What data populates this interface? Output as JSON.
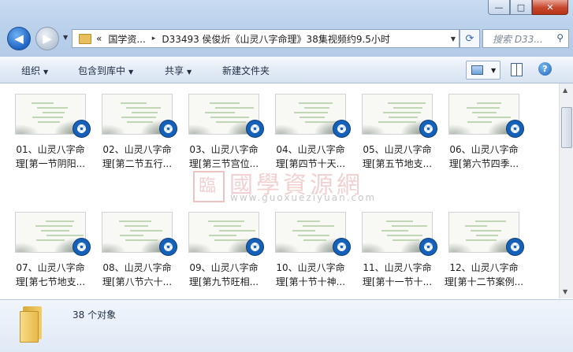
{
  "window": {
    "buttons": {
      "minimize": "—",
      "maximize": "□",
      "close": "✕"
    }
  },
  "nav": {
    "back": "back-icon",
    "forward": "forward-icon"
  },
  "address": {
    "chevron": "«",
    "segments": [
      "国学资...",
      "D33493 侯俊炘《山灵八字命理》38集视频约9.5小时"
    ],
    "separator": "▸"
  },
  "search": {
    "placeholder": "搜索 D33..."
  },
  "toolbar": {
    "organize": "组织",
    "include_library": "包含到库中",
    "share": "共享",
    "new_folder": "新建文件夹"
  },
  "files": [
    {
      "line1": "01、山灵八字命",
      "line2": "理[第一节阴阳..."
    },
    {
      "line1": "02、山灵八字命",
      "line2": "理[第二节五行..."
    },
    {
      "line1": "03、山灵八字命",
      "line2": "理[第三节宫位..."
    },
    {
      "line1": "04、山灵八字命",
      "line2": "理[第四节十天..."
    },
    {
      "line1": "05、山灵八字命",
      "line2": "理[第五节地支..."
    },
    {
      "line1": "06、山灵八字命",
      "line2": "理[第六节四季..."
    },
    {
      "line1": "07、山灵八字命",
      "line2": "理[第七节地支..."
    },
    {
      "line1": "08、山灵八字命",
      "line2": "理[第八节六十..."
    },
    {
      "line1": "09、山灵八字命",
      "line2": "理[第九节旺相..."
    },
    {
      "line1": "10、山灵八字命",
      "line2": "理[第十节十神..."
    },
    {
      "line1": "11、山灵八字命",
      "line2": "理[第十一节十..."
    },
    {
      "line1": "12、山灵八字命",
      "line2": "理[第十二节案例..."
    }
  ],
  "watermark": {
    "seal": "臨",
    "text": "國學資源網",
    "url": "www.guoxueziyuan.com"
  },
  "details": {
    "count": "38 个对象"
  },
  "colors": {
    "badge": "#1560b8",
    "accent": "#bcd2ec"
  }
}
